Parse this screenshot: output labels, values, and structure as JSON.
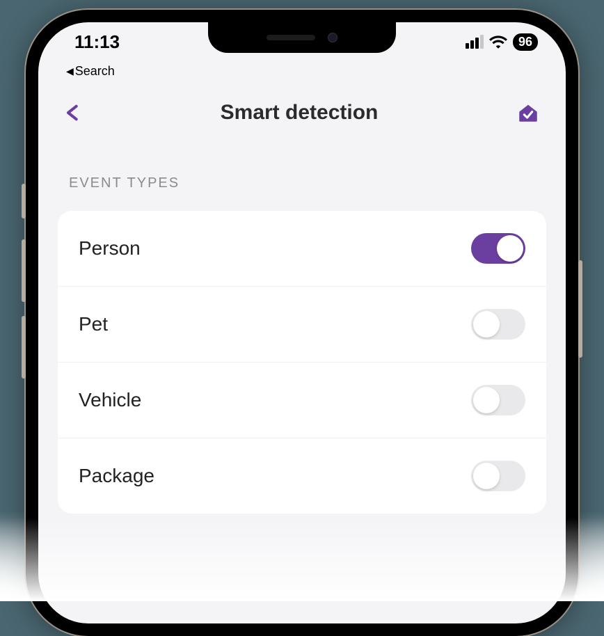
{
  "status": {
    "time": "11:13",
    "back_crumb": "Search",
    "battery": "96"
  },
  "header": {
    "title": "Smart detection"
  },
  "section": {
    "label": "EVENT TYPES"
  },
  "event_types": [
    {
      "label": "Person",
      "enabled": true
    },
    {
      "label": "Pet",
      "enabled": false
    },
    {
      "label": "Vehicle",
      "enabled": false
    },
    {
      "label": "Package",
      "enabled": false
    }
  ],
  "colors": {
    "accent": "#6b3fa0",
    "screen_bg": "#f4f3f6"
  }
}
